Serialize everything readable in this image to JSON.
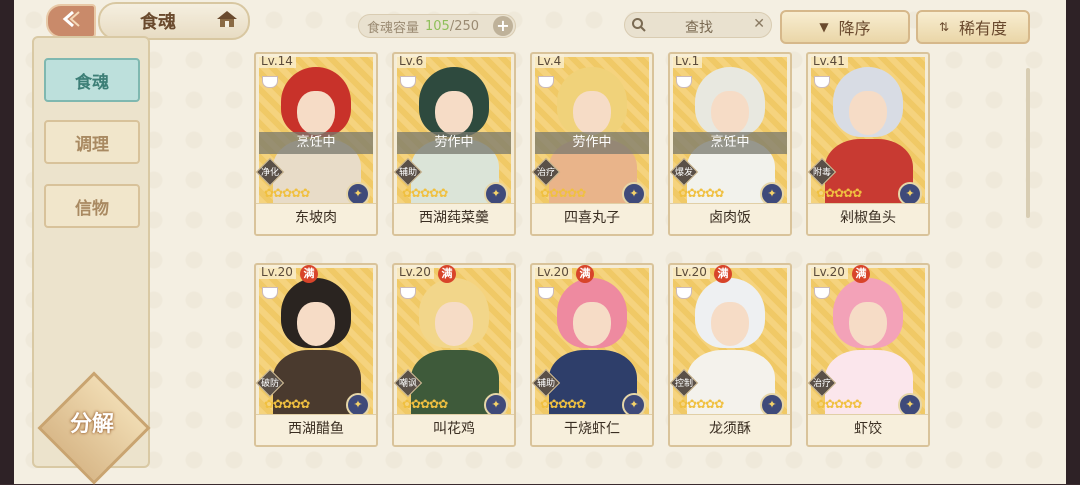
{
  "header": {
    "title": "食魂",
    "capacity_label": "食魂容量",
    "capacity_current": "105",
    "capacity_total": "/250",
    "search_placeholder": "查找",
    "sort_order": "降序",
    "sort_by": "稀有度"
  },
  "sidebar": {
    "items": [
      {
        "label": "食魂",
        "active": true
      },
      {
        "label": "调理",
        "active": false
      },
      {
        "label": "信物",
        "active": false
      }
    ],
    "decompose_label": "分解"
  },
  "cards": [
    {
      "level": "Lv.14",
      "max": "",
      "status": "烹饪中",
      "role": "净化",
      "name": "东坡肉",
      "hair": "#c8322a",
      "body": "#e8dcc8"
    },
    {
      "level": "Lv.6",
      "max": "",
      "status": "劳作中",
      "role": "辅助",
      "name": "西湖莼菜羹",
      "hair": "#2e4a3e",
      "body": "#dbe4d8"
    },
    {
      "level": "Lv.4",
      "max": "",
      "status": "劳作中",
      "role": "治疗",
      "name": "四喜丸子",
      "hair": "#f0d27a",
      "body": "#e9b48a"
    },
    {
      "level": "Lv.1",
      "max": "",
      "status": "烹饪中",
      "role": "爆发",
      "name": "卤肉饭",
      "hair": "#e8e8e0",
      "body": "#f2f2ec"
    },
    {
      "level": "Lv.41",
      "max": "",
      "status": "",
      "role": "附毒",
      "name": "剁椒鱼头",
      "hair": "#d8dce4",
      "body": "#c83a32"
    },
    {
      "level": "Lv.20",
      "max": "满",
      "status": "",
      "role": "破防",
      "name": "西湖醋鱼",
      "hair": "#2a2420",
      "body": "#4a3a2e"
    },
    {
      "level": "Lv.20",
      "max": "满",
      "status": "",
      "role": "嘲讽",
      "name": "叫花鸡",
      "hair": "#f2d68a",
      "body": "#3e5a3a"
    },
    {
      "level": "Lv.20",
      "max": "满",
      "status": "",
      "role": "辅助",
      "name": "干烧虾仁",
      "hair": "#ee8aa0",
      "body": "#2e3e6a"
    },
    {
      "level": "Lv.20",
      "max": "满",
      "status": "",
      "role": "控制",
      "name": "龙须酥",
      "hair": "#eef0f2",
      "body": "#f4f2ec"
    },
    {
      "level": "Lv.20",
      "max": "满",
      "status": "",
      "role": "治疗",
      "name": "虾饺",
      "hair": "#f3a2b8",
      "body": "#fbe6ec"
    }
  ],
  "colors": {
    "accent_active": "#bde0dc",
    "max_badge": "#d8442a",
    "capacity_current": "#8fbf5a"
  },
  "icons": [
    "back-arrow-icon",
    "house-icon",
    "plus-icon",
    "search-icon",
    "close-icon",
    "sort-desc-icon",
    "sort-rarity-icon",
    "bowl-icon",
    "star-icon",
    "element-gem-icon"
  ]
}
